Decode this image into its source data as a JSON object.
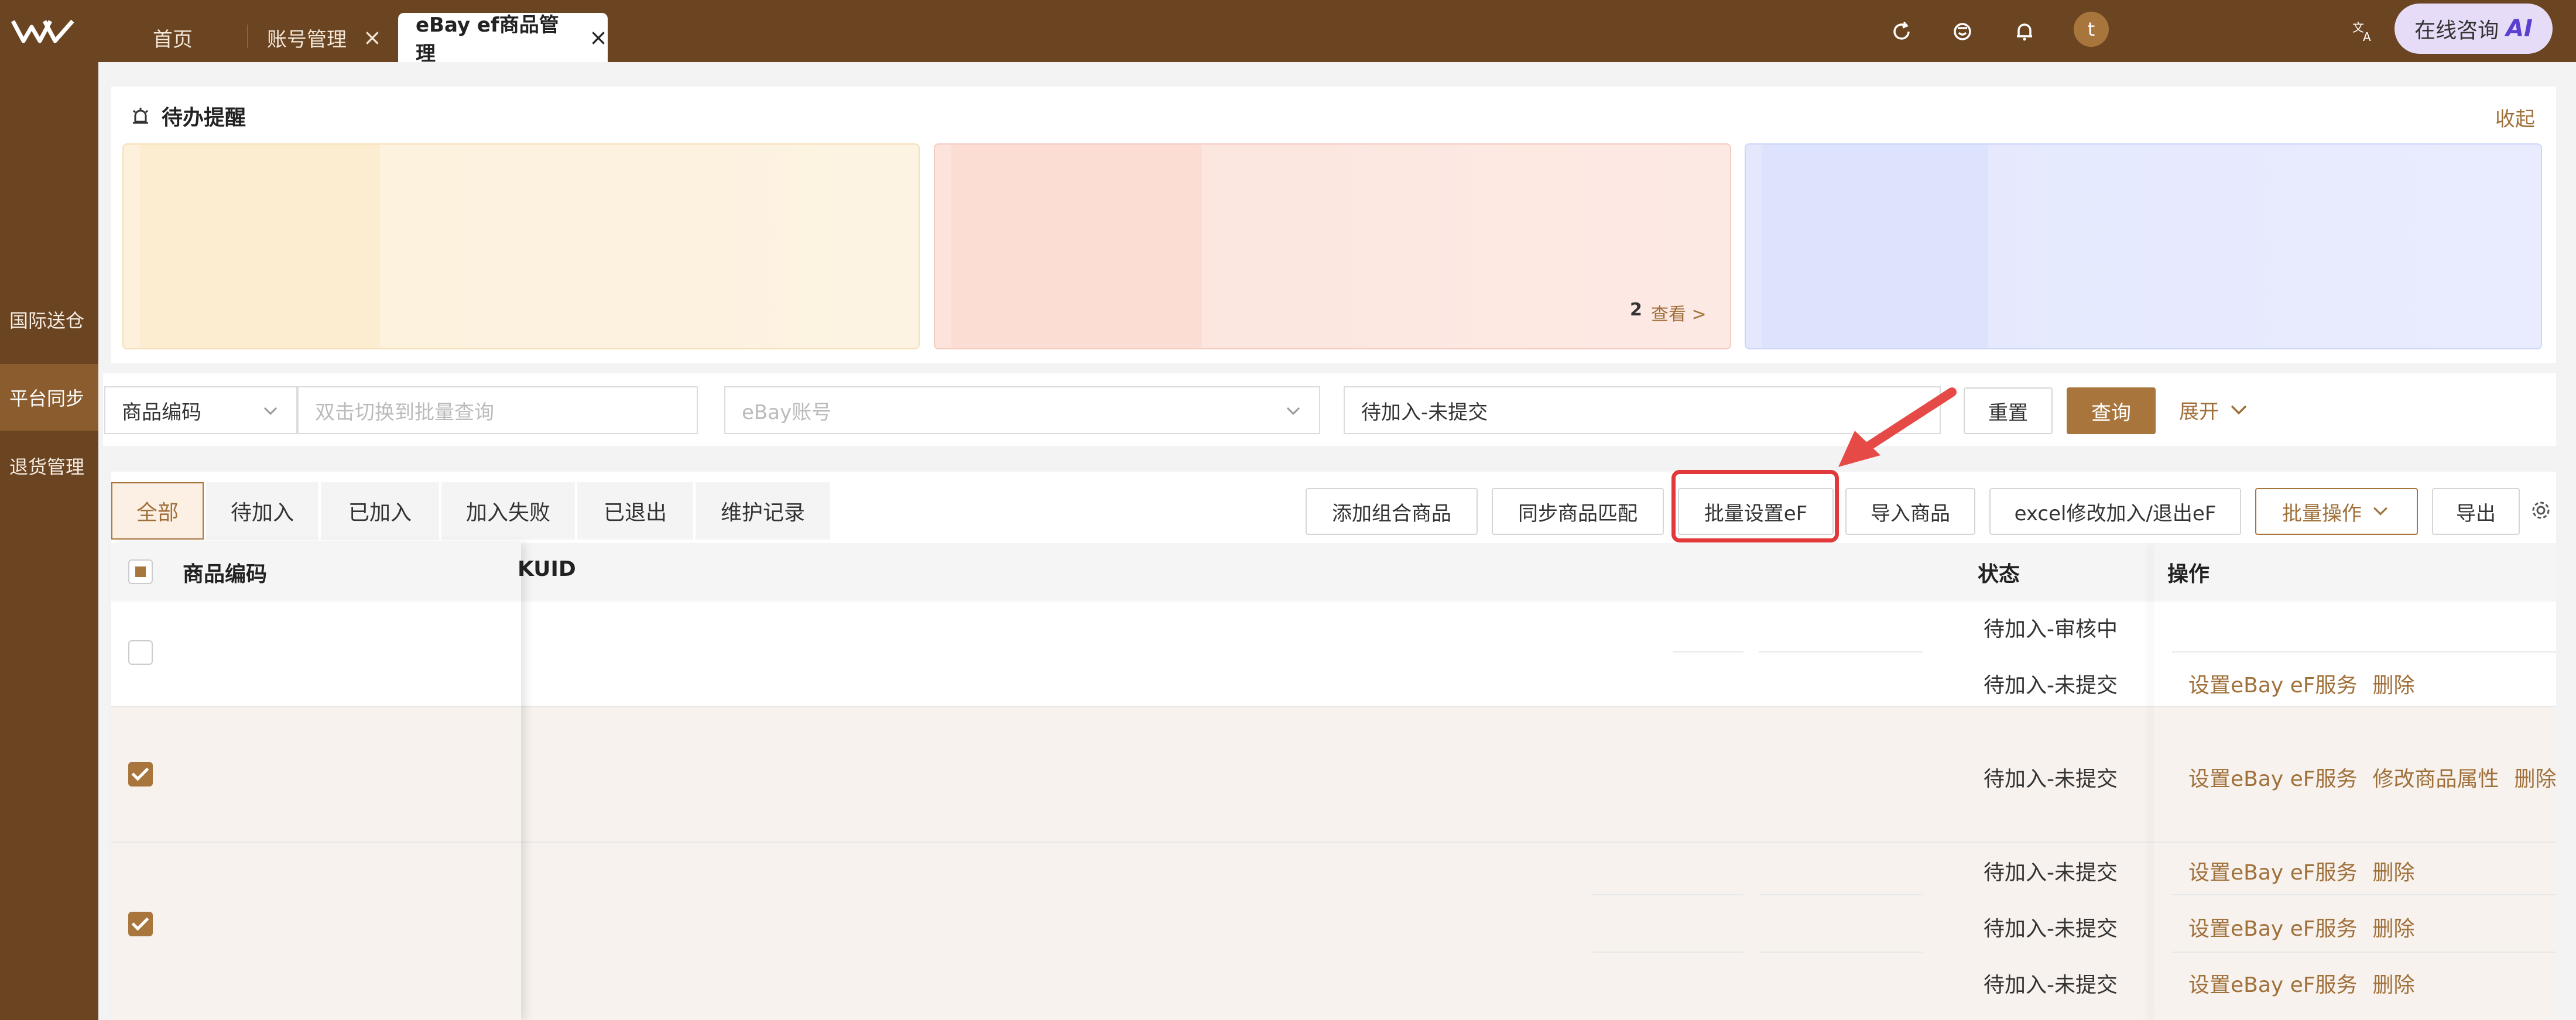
{
  "header": {
    "tabs": [
      {
        "label": "首页"
      },
      {
        "label": "账号管理",
        "close": "×"
      },
      {
        "label": "eBay ef商品管理",
        "close": "×"
      }
    ],
    "avatar_letter": "t",
    "chat_label": "在线咨询",
    "chat_badge": "AI"
  },
  "sidebar": {
    "items": [
      {
        "label": "国际送仓"
      },
      {
        "label": "平台同步"
      },
      {
        "label": "退货管理"
      }
    ]
  },
  "todo": {
    "title": "待办提醒",
    "collapse": "收起",
    "card_count": "2",
    "card_view": "查看 >"
  },
  "filters": {
    "field_select": "商品编码",
    "search_placeholder": "双击切换到批量查询",
    "account_placeholder": "eBay账号",
    "status_value": "待加入-未提交",
    "reset": "重置",
    "query": "查询",
    "expand": "展开"
  },
  "status_tabs": [
    "全部",
    "待加入",
    "已加入",
    "加入失败",
    "已退出",
    "维护记录"
  ],
  "actions": {
    "add_combo": "添加组合商品",
    "sync_match": "同步商品匹配",
    "batch_set": "批量设置eF",
    "import": "导入商品",
    "excel_modify": "excel修改加入/退出eF",
    "batch_ops": "批量操作",
    "export": "导出"
  },
  "table": {
    "headers": {
      "code": "商品编码",
      "skuid": "KUID",
      "status": "状态",
      "ops": "操作"
    },
    "rows": [
      {
        "status": "待加入-审核中",
        "ops": []
      },
      {
        "status": "待加入-未提交",
        "ops": [
          "设置eBay eF服务",
          "删除"
        ]
      },
      {
        "status": "待加入-未提交",
        "ops": [
          "设置eBay eF服务",
          "修改商品属性",
          "删除"
        ]
      },
      {
        "status": "待加入-未提交",
        "ops": [
          "设置eBay eF服务",
          "删除"
        ]
      },
      {
        "status": "待加入-未提交",
        "ops": [
          "设置eBay eF服务",
          "删除"
        ]
      },
      {
        "status": "待加入-未提交",
        "ops": [
          "设置eBay eF服务",
          "删除"
        ]
      }
    ]
  },
  "colors": {
    "brand": "#6b4421",
    "accent": "#a8763d",
    "highlight": "#e23a3a"
  }
}
